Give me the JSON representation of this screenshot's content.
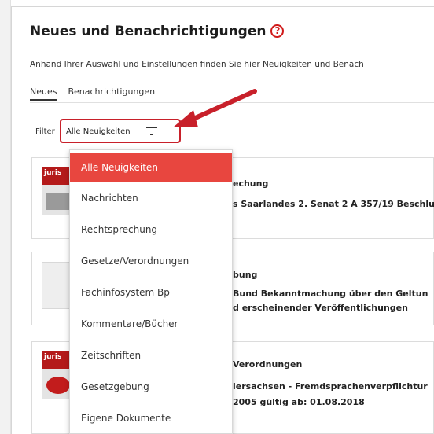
{
  "header": {
    "title": "Neues und Benachrichtigungen",
    "help_icon": "?",
    "description": "Anhand Ihrer Auswahl und Einstellungen finden Sie hier Neuigkeiten und Benach"
  },
  "tabs": [
    {
      "label": "Neues"
    },
    {
      "label": "Benachrichtigungen"
    }
  ],
  "filter": {
    "label": "Filter",
    "value": "Alle Neuigkeiten",
    "icon": "filter-icon"
  },
  "menu": {
    "items": [
      {
        "label": "Alle Neuigkeiten"
      },
      {
        "label": "Nachrichten"
      },
      {
        "label": "Rechtsprechung"
      },
      {
        "label": "Gesetze/Verordnungen"
      },
      {
        "label": "Fachinfosystem Bp"
      },
      {
        "label": "Kommentare/Bücher"
      },
      {
        "label": "Zeitschriften"
      },
      {
        "label": "Gesetzgebung"
      },
      {
        "label": "Eigene Dokumente"
      }
    ]
  },
  "cards": [
    {
      "thumb_label": "juris",
      "line1": "echung",
      "line2": "s Saarlandes 2. Senat 2 A 357/19 Beschlu"
    },
    {
      "thumb_label": "",
      "line1": "bung",
      "line2": "Bund Bekanntmachung über den Geltun",
      "line3": "d erscheinender Veröffentlichungen"
    },
    {
      "thumb_label": "juris",
      "line1": "Verordnungen",
      "line2": "lersachsen - Fremdsprachenverpflichtur",
      "line3": "2005 gültig ab: 01.08.2018"
    }
  ],
  "colors": {
    "accent_red": "#c8202a",
    "selected_item": "#e8463f",
    "arrow": "#c8202a"
  }
}
